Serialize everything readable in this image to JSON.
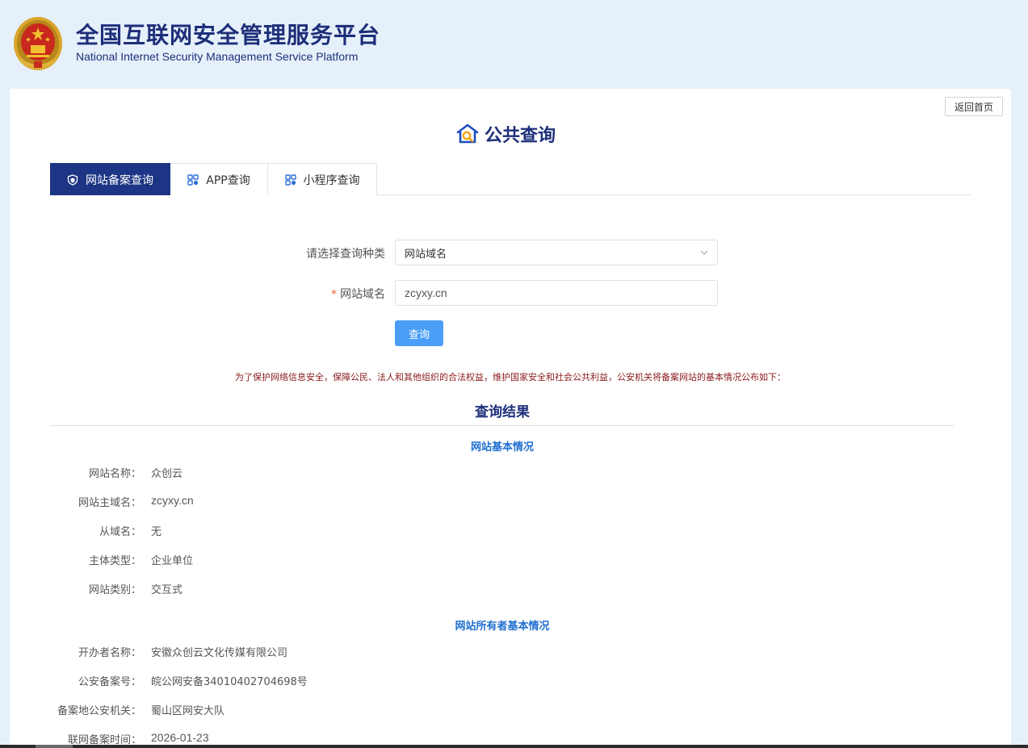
{
  "header": {
    "title_cn": "全国互联网安全管理服务平台",
    "title_en": "National Internet Security Management Service Platform"
  },
  "toolbar": {
    "back_label": "返回首页"
  },
  "page": {
    "heading": "公共查询"
  },
  "tabs": [
    {
      "label": "网站备案查询",
      "icon": "shield-icon",
      "active": true
    },
    {
      "label": "APP查询",
      "icon": "apps-grid-icon",
      "active": false
    },
    {
      "label": "小程序查询",
      "icon": "apps-grid-icon",
      "active": false
    }
  ],
  "form": {
    "type_label": "请选择查询种类",
    "type_value": "网站域名",
    "required_mark": "*",
    "domain_label": "网站域名",
    "domain_value": "zcyxy.cn",
    "query_label": "查询"
  },
  "notice": "为了保护网络信息安全，保障公民、法人和其他组织的合法权益，维护国家安全和社会公共利益，公安机关将备案网站的基本情况公布如下：",
  "result": {
    "title": "查询结果",
    "site_section": "网站基本情况",
    "site_rows": [
      {
        "k": "网站名称：",
        "v": "众创云"
      },
      {
        "k": "网站主域名：",
        "v": "zcyxy.cn"
      },
      {
        "k": "从域名：",
        "v": "无"
      },
      {
        "k": "主体类型：",
        "v": "企业单位"
      },
      {
        "k": "网站类别：",
        "v": "交互式"
      }
    ],
    "owner_section": "网站所有者基本情况",
    "owner_rows": [
      {
        "k": "开办者名称：",
        "v": "安徽众创云文化传媒有限公司"
      },
      {
        "k": "公安备案号：",
        "v": "皖公网安备34010402704698号"
      },
      {
        "k": "备案地公安机关：",
        "v": "蜀山区网安大队"
      },
      {
        "k": "联网备案时间：",
        "v": "2026-01-23"
      }
    ]
  },
  "colors": {
    "brand_navy": "#1d2f7a",
    "tab_active": "#1d3585",
    "button_blue": "#4a9ef7",
    "notice_red": "#8b1a1a",
    "section_blue": "#1f6fd0",
    "page_bg": "#e6f0fa"
  }
}
